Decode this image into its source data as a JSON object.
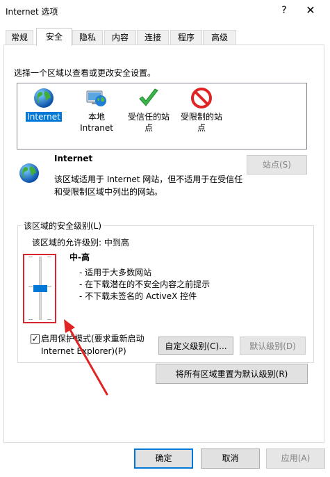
{
  "window": {
    "title": "Internet 选项",
    "help_symbol": "?",
    "close_symbol": "✕"
  },
  "tabs": [
    {
      "label": "常规",
      "active": false
    },
    {
      "label": "安全",
      "active": true
    },
    {
      "label": "隐私",
      "active": false
    },
    {
      "label": "内容",
      "active": false
    },
    {
      "label": "连接",
      "active": false
    },
    {
      "label": "程序",
      "active": false
    },
    {
      "label": "高级",
      "active": false
    }
  ],
  "security": {
    "zone_prompt": "选择一个区域以查看或更改安全设置。",
    "zones": [
      {
        "line1": "Internet",
        "line2": "",
        "icon": "globe-icon",
        "selected": true
      },
      {
        "line1": "本地",
        "line2": "Intranet",
        "icon": "local-intranet-icon",
        "selected": false
      },
      {
        "line1": "受信任的站",
        "line2": "点",
        "icon": "checkmark-icon",
        "selected": false
      },
      {
        "line1": "受限制的站",
        "line2": "点",
        "icon": "no-entry-icon",
        "selected": false
      }
    ],
    "selected_zone_title": "Internet",
    "selected_zone_desc_1": "该区域适用于 Internet 网站，但不适用于在受信任",
    "selected_zone_desc_2": "和受限制区域中列出的网站。",
    "sites_button": "站点(S)",
    "level_group_label": "该区域的安全级别(L)",
    "allowed_level": "该区域的允许级别: 中到高",
    "slider_level_fraction": 0.5,
    "level_name": "中-高",
    "bullets": [
      "- 适用于大多数网站",
      "- 在下载潜在的不安全内容之前提示",
      "- 不下载未签名的 ActiveX 控件"
    ],
    "protected_mode_checked": true,
    "protected_mode_label_1": "启用保护模式(要求重新启动",
    "protected_mode_label_2": "Internet Explorer)(P)",
    "custom_level_button": "自定义级别(C)...",
    "default_level_button": "默认级别(D)",
    "reset_all_button": "将所有区域重置为默认级别(R)"
  },
  "footer": {
    "ok": "确定",
    "cancel": "取消",
    "apply": "应用(A)"
  },
  "colors": {
    "accent": "#0078d7",
    "highlight_box": "#d9232e"
  }
}
